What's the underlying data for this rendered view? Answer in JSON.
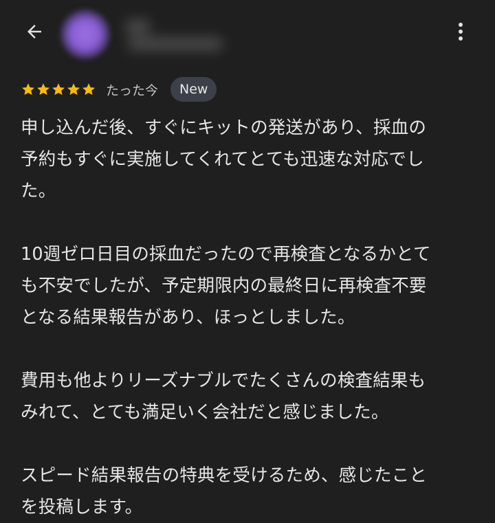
{
  "header": {
    "back_icon": "arrow-left-icon",
    "more_icon": "more-vert-icon",
    "avatar_color": "#8a5fd6"
  },
  "review": {
    "rating": 5,
    "star_color": "#fbbc04",
    "time": "たった今",
    "badge": "New",
    "paragraphs": [
      "申し込んだ後、すぐにキットの発送があり、採血の\n予約もすぐに実施してくれてとても迅速な対応でし\nた。",
      "10週ゼロ日目の採血だったので再検査となるかとて\nも不安でしたが、予定期限内の最終日に再検査不要\nとなる結果報告があり、ほっとしました。",
      "費用も他よりリーズナブルでたくさんの検査結果も\nみれて、とても満足いく会社だと感じました。",
      "スピード結果報告の特典を受けるため、感じたこと\nを投稿します。"
    ]
  }
}
